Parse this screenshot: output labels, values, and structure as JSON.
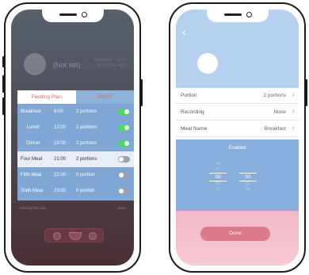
{
  "left_screen": {
    "profile": {
      "name": "(Not set)",
      "meta_line1": "Remember : 18:00",
      "meta_line2": "2023.10.xx  3000"
    },
    "tabs": {
      "feeding_plan": "Feeding Plan",
      "modify": "Modify"
    },
    "meals": [
      {
        "name": "Breakfast",
        "time": "8:00",
        "portions": "2 portions",
        "enabled": true
      },
      {
        "name": "Lunch",
        "time": "12:00",
        "portions": "2 portions",
        "enabled": true
      },
      {
        "name": "Dinner",
        "time": "18:00",
        "portions": "2 portions",
        "enabled": true
      },
      {
        "name": "Four Meal",
        "time": "21:00",
        "portions": "2 portions",
        "enabled": false
      },
      {
        "name": "Fifth Meal",
        "time": "22:00",
        "portions": "0 portion",
        "enabled": false
      },
      {
        "name": "Sixth Meal",
        "time": "23:00",
        "portions": "0 portion",
        "enabled": false
      }
    ],
    "records": {
      "label": "Feeding Records",
      "more": "More"
    }
  },
  "right_screen": {
    "back_icon": "chevron-left-icon",
    "settings": [
      {
        "label": "Portion",
        "value": "2 portions"
      },
      {
        "label": "Recording",
        "value": "None"
      },
      {
        "label": "Meal Name",
        "value": "Breakfast"
      }
    ],
    "enabled_label": "Enabled",
    "picker": {
      "hours": [
        "06",
        "07",
        "08",
        "09",
        "10"
      ],
      "minutes": [
        "",
        "",
        "00",
        "01",
        "02"
      ],
      "selected_hour": "08",
      "selected_minute": "00",
      "separator": ":"
    },
    "done_label": "Done"
  },
  "colors": {
    "toggle_on": "#4cd964",
    "accent_pink": "#dd7a88",
    "panel_blue": "#87aedc"
  }
}
